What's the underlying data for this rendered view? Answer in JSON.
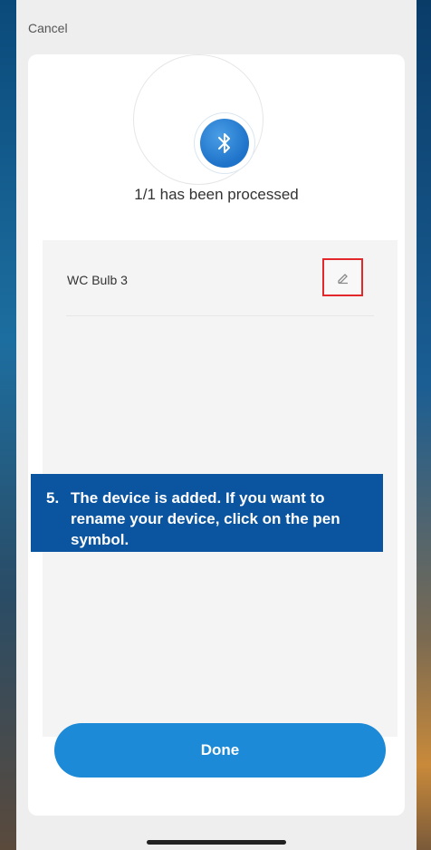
{
  "header": {
    "cancel_label": "Cancel"
  },
  "status": {
    "processed_text": "1/1 has been processed",
    "icon": "bluetooth-icon"
  },
  "devices": [
    {
      "name": "WC Bulb 3",
      "edit_icon": "pen-icon"
    }
  ],
  "callout": {
    "number": "5.",
    "text": "The device is added. If you want to rename your device, click on the pen symbol."
  },
  "footer": {
    "done_label": "Done"
  },
  "colors": {
    "accent": "#1c8ad6",
    "callout_bg": "#0b55a0",
    "highlight": "#e2282a"
  }
}
